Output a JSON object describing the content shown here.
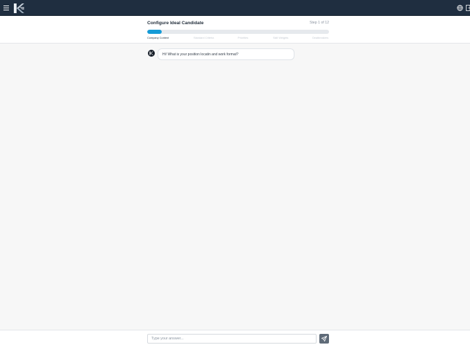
{
  "topbar": {
    "icons": {
      "menu": "hamburger-menu-icon",
      "logo": "k-logo",
      "language": "globe-icon",
      "logout": "exit-icon"
    }
  },
  "header": {
    "title": "Configure Ideal Candidate",
    "step_text": "Step 1 of 12",
    "progress_percent": 8,
    "steps": [
      {
        "label": "Company Context",
        "active": true
      },
      {
        "label": "Standard Criteria",
        "active": false
      },
      {
        "label": "Priorities",
        "active": false
      },
      {
        "label": "Skill Weights",
        "active": false
      },
      {
        "label": "Dealbreakers",
        "active": false
      }
    ]
  },
  "chat": {
    "messages": [
      {
        "sender": "bot",
        "text": "Hi! What is your position locatin and work format?"
      }
    ]
  },
  "footer": {
    "input_value": "",
    "input_placeholder": "Type your answer...",
    "send_icon": "send-icon"
  },
  "colors": {
    "topbar": "#1f2e40",
    "accent": "#159bd7",
    "send_button": "#5f6b78",
    "background": "#f7f7f7"
  }
}
